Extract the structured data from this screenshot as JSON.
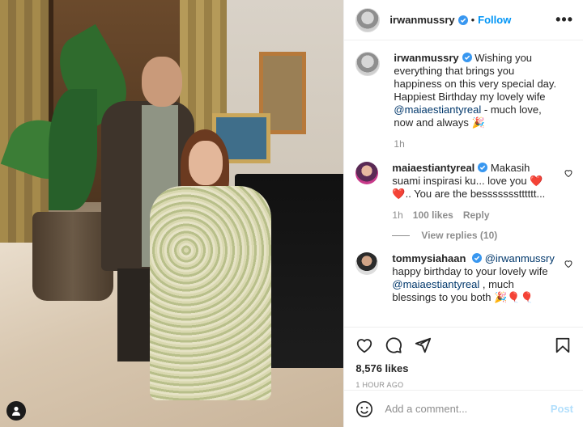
{
  "post": {
    "username": "irwanmussry",
    "follow_label": "Follow",
    "dot": "•",
    "more": "•••"
  },
  "comments": [
    {
      "username": "irwanmussry",
      "text_before": " Wishing you everything that brings you happiness on this very special day. Happiest Birthday my lovely wife ",
      "mention": "@maiaestiantyreal",
      "text_after": " - much love, now and always 🎉",
      "time": "1h"
    },
    {
      "username": "maiaestiantyreal",
      "text": " Makasih suami inspirasi ku... love you ❤️❤️.. You are the bessssssstttttt...",
      "time": "1h",
      "likes": "100 likes",
      "reply": "Reply",
      "view_replies": "View replies (10)"
    },
    {
      "username": "tommysiahaan",
      "mention1": "@irwanmussry",
      "line2": "happy birthday to your lovely wife",
      "mention2": "@maiaestiantyreal",
      "text_after": " , much blessings to you both 🎉🎈🎈"
    }
  ],
  "footer": {
    "likes": "8,576 likes",
    "time_ago": "1 HOUR AGO",
    "comment_placeholder": "Add a comment...",
    "post_label": "Post"
  },
  "colors": {
    "link": "#0095f6",
    "verified": "#3897f0",
    "heart": "#ed4956"
  }
}
